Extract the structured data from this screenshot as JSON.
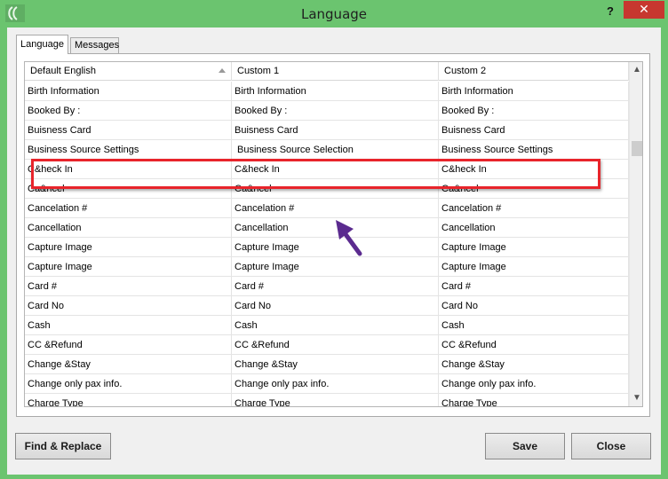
{
  "window": {
    "title": "Language",
    "help_label": "?",
    "close_label": "✕"
  },
  "tabs": [
    {
      "label": "Language",
      "active": true
    },
    {
      "label": "Messages",
      "active": false
    }
  ],
  "grid": {
    "columns": [
      "Default English",
      "Custom 1",
      "Custom 2"
    ],
    "rows": [
      [
        "Birth Information",
        "Birth Information",
        "Birth Information"
      ],
      [
        "Booked By :",
        "Booked By :",
        "Booked By :"
      ],
      [
        "Buisness Card",
        "Buisness Card",
        "Buisness Card"
      ],
      [
        "Business Source Settings",
        "Business Source Selection",
        "Business Source Settings"
      ],
      [
        "C&heck In",
        "C&heck In",
        "C&heck In"
      ],
      [
        "Ca&ncel",
        "Ca&ncel",
        "Ca&ncel"
      ],
      [
        "Cancelation #",
        "Cancelation #",
        "Cancelation #"
      ],
      [
        "Cancellation",
        "Cancellation",
        "Cancellation"
      ],
      [
        "Capture Image",
        "Capture Image",
        "Capture Image"
      ],
      [
        "Capture Image",
        "Capture Image",
        "Capture Image"
      ],
      [
        "Card #",
        "Card #",
        "Card #"
      ],
      [
        "Card No",
        "Card No",
        "Card No"
      ],
      [
        "Cash",
        "Cash",
        "Cash"
      ],
      [
        "CC &Refund",
        "CC &Refund",
        "CC &Refund"
      ],
      [
        "Change &Stay",
        "Change &Stay",
        "Change &Stay"
      ],
      [
        "Change only pax info.",
        "Change only pax info.",
        "Change only pax info."
      ],
      [
        "Charge Type",
        "Charge Type",
        "Charge Type"
      ]
    ]
  },
  "buttons": {
    "find_replace": "Find & Replace",
    "save": "Save",
    "close": "Close"
  },
  "colors": {
    "titlebar": "#6bc46f",
    "highlight": "#e8242b",
    "arrow": "#5b2b8f",
    "close_button": "#c7372f"
  }
}
